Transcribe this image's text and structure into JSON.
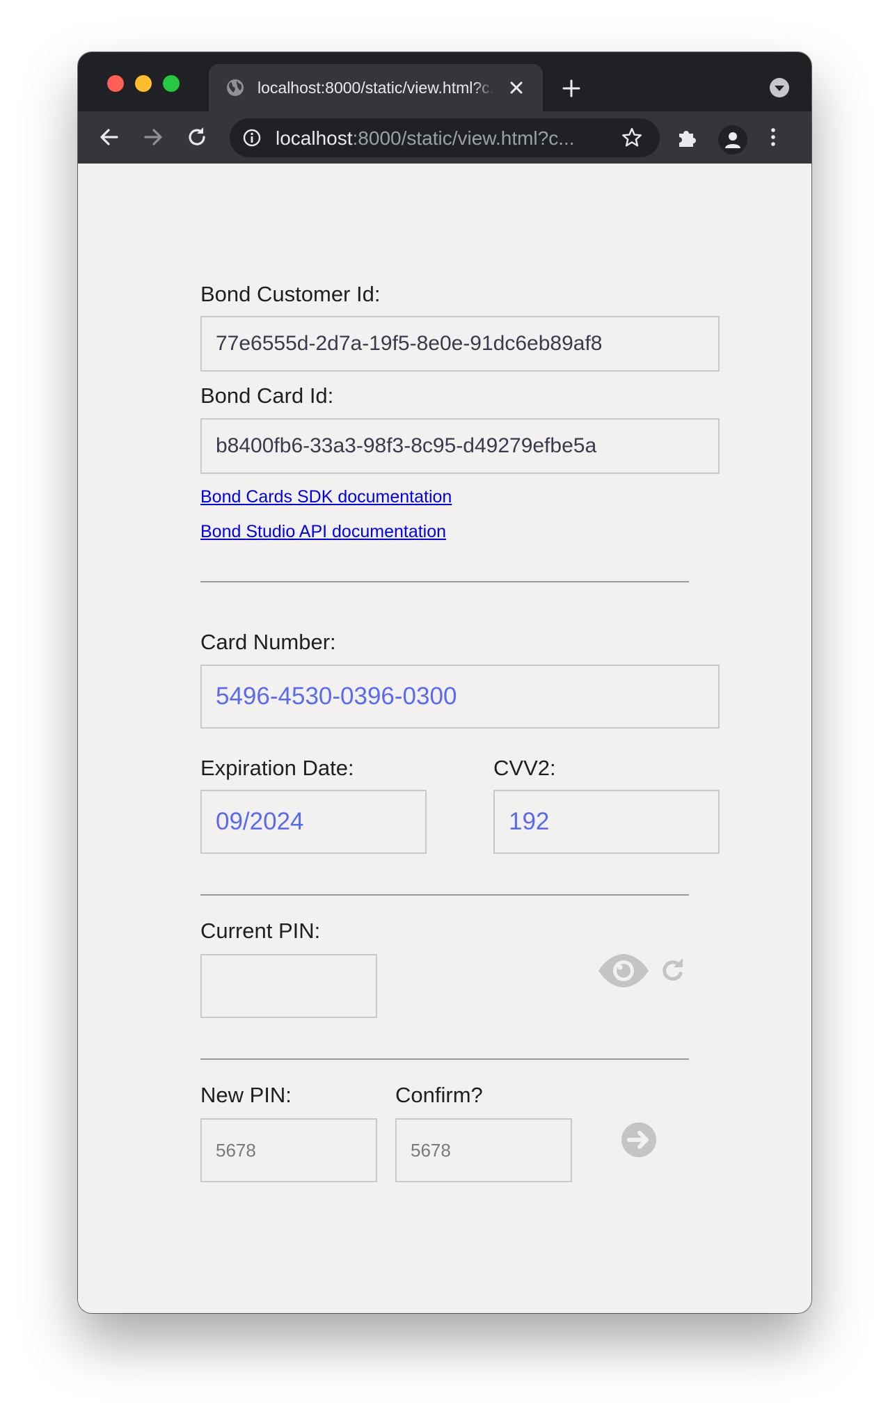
{
  "browser": {
    "tab_title": "localhost:8000/static/view.html?c...",
    "url_host": "localhost",
    "url_rest": ":8000/static/view.html?c..."
  },
  "form": {
    "customer_id_label": "Bond Customer Id:",
    "customer_id_value": "77e6555d-2d7a-19f5-8e0e-91dc6eb89af8",
    "card_id_label": "Bond Card Id:",
    "card_id_value": "b8400fb6-33a3-98f3-8c95-d49279efbe5a",
    "links": [
      "Bond Cards SDK documentation",
      "Bond Studio API documentation"
    ],
    "card_number_label": "Card Number:",
    "card_number_value": "5496-4530-0396-0300",
    "expiration_label": "Expiration Date:",
    "expiration_value": "09/2024",
    "cvv_label": "CVV2:",
    "cvv_value": "192",
    "current_pin_label": "Current PIN:",
    "current_pin_value": "",
    "new_pin_label": "New PIN:",
    "new_pin_placeholder": "5678",
    "confirm_label": "Confirm?",
    "confirm_placeholder": "5678"
  },
  "icons": {
    "favicon": "globe-icon",
    "tab_close": "close-icon",
    "new_tab": "plus-icon",
    "tab_search": "chevron-down-icon",
    "back": "arrow-left-icon",
    "forward": "arrow-right-icon",
    "reload": "reload-icon",
    "site_info": "info-icon",
    "bookmark": "star-icon",
    "extensions": "puzzle-icon",
    "profile": "person-icon",
    "menu": "kebab-menu-icon",
    "show_pin": "eye-icon",
    "refresh_pin": "refresh-icon",
    "submit_pin": "arrow-circle-right-icon"
  },
  "colors": {
    "titlebar": "#202124",
    "toolbar": "#35363a",
    "page_background": "#f2f1f0",
    "card_value_text": "#5a6af0",
    "link": "#0000ee",
    "disabled_icon": "#c4c4c4"
  }
}
